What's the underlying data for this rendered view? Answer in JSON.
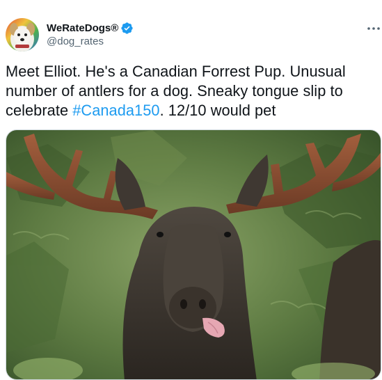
{
  "author": {
    "display_name": "WeRateDogs®",
    "handle": "@dog_rates",
    "avatar_icon": "dog-avatar",
    "verified_icon": "verified-badge-icon",
    "verified_color": "#1d9bf0"
  },
  "more_icon": "more-options-icon",
  "tweet": {
    "text_before": "Meet Elliot. He's a Canadian Forrest Pup. Unusual number of antlers for a dog. Sneaky tongue slip to celebrate ",
    "hashtag": "#Canada150",
    "text_after": ". 12/10 would pet",
    "hashtag_color": "#1d9bf0"
  },
  "media": {
    "subject": "moose-photo"
  }
}
